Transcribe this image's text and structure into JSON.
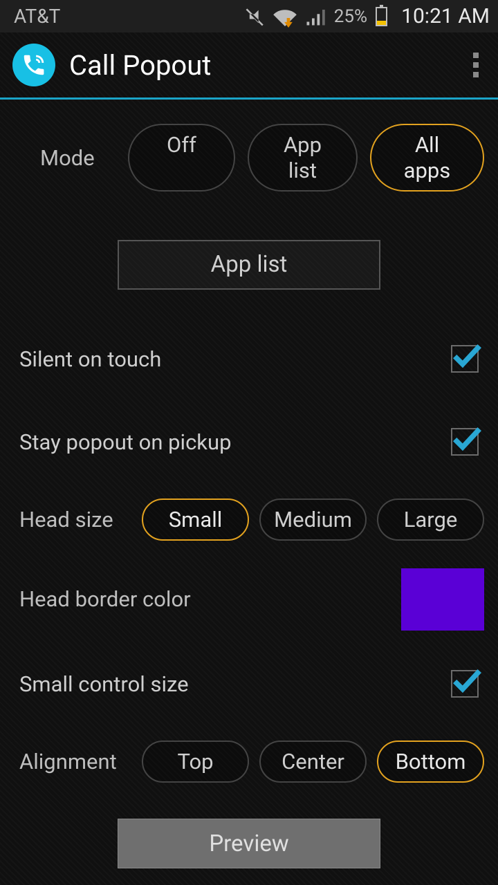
{
  "statusbar": {
    "carrier": "AT&T",
    "battery_pct": "25%",
    "time": "10:21 AM"
  },
  "actionbar": {
    "title": "Call Popout"
  },
  "mode": {
    "label": "Mode",
    "options": [
      "Off",
      "App list",
      "All apps"
    ],
    "selected": "All apps"
  },
  "applist_button": "App list",
  "settings": {
    "silent_on_touch": {
      "label": "Silent on touch",
      "checked": true
    },
    "stay_popout": {
      "label": "Stay popout on pickup",
      "checked": true
    },
    "small_control": {
      "label": "Small control size",
      "checked": true
    }
  },
  "head_size": {
    "label": "Head size",
    "options": [
      "Small",
      "Medium",
      "Large"
    ],
    "selected": "Small"
  },
  "head_border_color": {
    "label": "Head border color",
    "hex": "#5a00d6"
  },
  "alignment": {
    "label": "Alignment",
    "options": [
      "Top",
      "Center",
      "Bottom"
    ],
    "selected": "Bottom"
  },
  "preview_button": "Preview"
}
